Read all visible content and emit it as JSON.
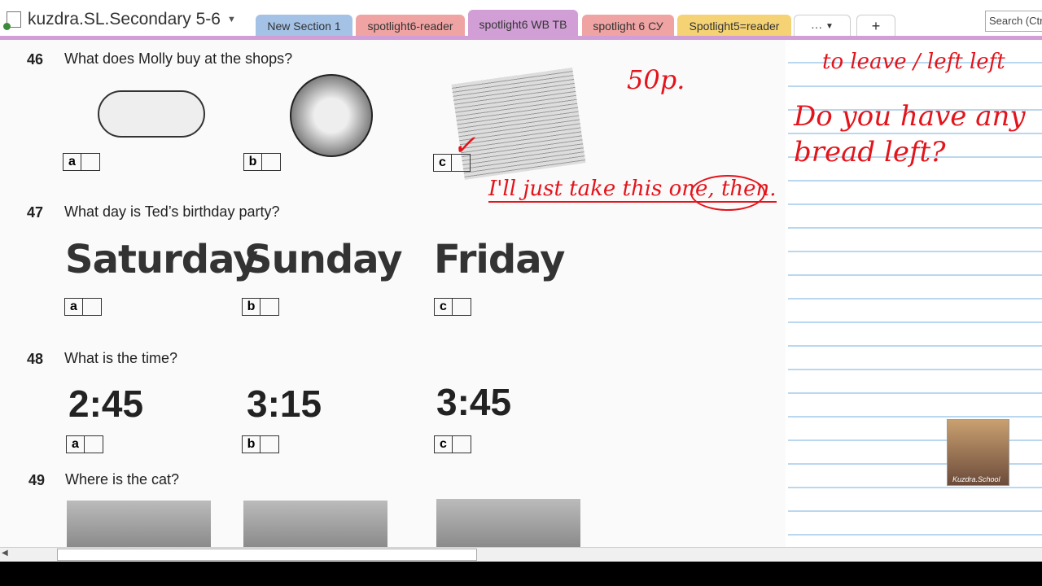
{
  "notebook": {
    "title": "kuzdra.SL.Secondary 5-6"
  },
  "tabs": [
    {
      "label": "New Section 1",
      "color": "#a4c2e6"
    },
    {
      "label": "spotlight6-reader",
      "color": "#f0a3a3"
    },
    {
      "label": "spotlight6 WB TB",
      "color": "#d19fd6",
      "active": true
    },
    {
      "label": "spotlight 6 СУ",
      "color": "#f0a3a3"
    },
    {
      "label": "Spotlight5=reader",
      "color": "#f5d274"
    }
  ],
  "more_label": "···",
  "add_label": "+",
  "search": {
    "placeholder": "Search (Ctrl"
  },
  "questions": [
    {
      "num": "46",
      "text": "What does Molly buy at the shops?",
      "options": [
        "a",
        "b",
        "c"
      ]
    },
    {
      "num": "47",
      "text": "What day is Ted’s birthday party?",
      "options": [
        "a",
        "b",
        "c"
      ],
      "choices": [
        "Saturday",
        "Sunday",
        "Friday"
      ]
    },
    {
      "num": "48",
      "text": "What is the time?",
      "options": [
        "a",
        "b",
        "c"
      ],
      "choices": [
        "2:45",
        "3:15",
        "3:45"
      ]
    },
    {
      "num": "49",
      "text": "Where is the cat?"
    }
  ],
  "handwriting": {
    "price": "50p.",
    "check": "✓",
    "sentence1": "I'll just take this one, then.",
    "vocab": "to leave / left left",
    "question": "Do you have any bread left?"
  },
  "avatar_label": "Kuzdra.School"
}
